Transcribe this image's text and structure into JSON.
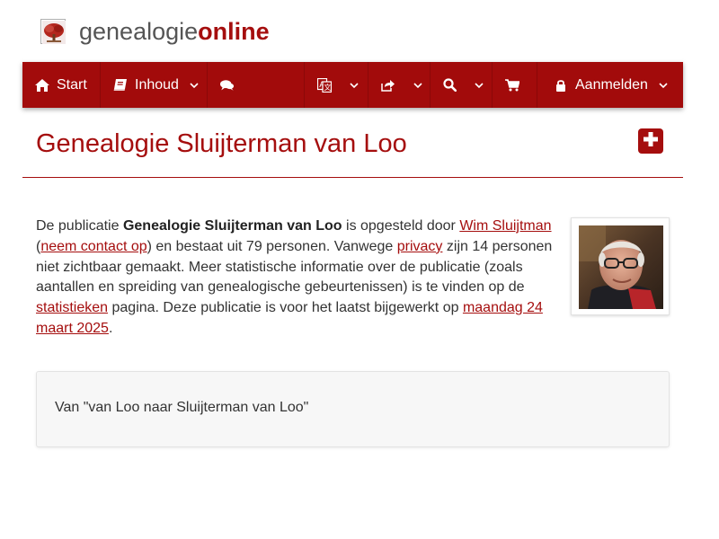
{
  "brand": {
    "part1": "genealogie",
    "part2": "online"
  },
  "nav": {
    "start": "Start",
    "inhoud": "Inhoud",
    "login": "Aanmelden"
  },
  "page": {
    "title": "Genealogie Sluijterman van Loo"
  },
  "intro": {
    "t1": "De publicatie ",
    "pub_name": "Genealogie Sluijterman van Loo",
    "t2": " is opgesteld door ",
    "author": "Wim Sluijtman",
    "t3": "(",
    "contact": "neem contact op",
    "t4": ") en bestaat uit 79 personen. Vanwege ",
    "privacy": "privacy",
    "t5": " zijn 14 personen niet zichtbaar gemaakt. Meer statistische informatie over de publicatie (zoals aantallen en spreiding van genealogische gebeurtenissen) is te vinden op de ",
    "stats": "statistieken",
    "t6": " pagina. Deze publicatie is voor het laatst bijgewerkt op ",
    "date": "maandag 24 maart 2025",
    "t7": "."
  },
  "well": {
    "text": "Van \"van Loo naar Sluijterman van Loo\""
  },
  "colors": {
    "brand_red": "#a20b0b",
    "text_red": "#a50e0e"
  },
  "icons": {
    "start": "home-icon",
    "inhoud": "book-icon",
    "chat": "comments-icon",
    "language": "translate-icon",
    "share": "share-icon",
    "search": "search-icon",
    "cart": "cart-icon",
    "login": "lock-icon"
  }
}
